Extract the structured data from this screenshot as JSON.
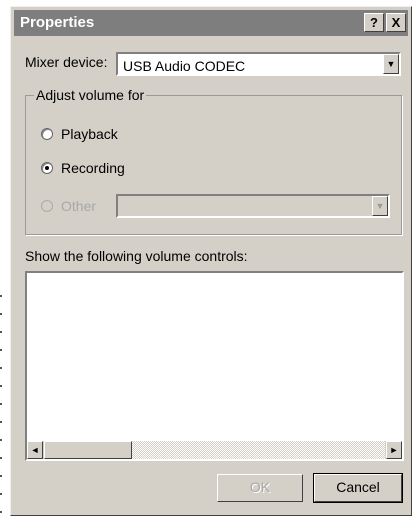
{
  "window": {
    "title": "Properties",
    "help_glyph": "?",
    "close_glyph": "X"
  },
  "mixer": {
    "label": "Mixer device:",
    "selected": "USB Audio CODEC",
    "arrow_glyph": "▼"
  },
  "adjust": {
    "legend": "Adjust volume for",
    "options": [
      {
        "label": "Playback",
        "checked": false,
        "enabled": true
      },
      {
        "label": "Recording",
        "checked": true,
        "enabled": true
      },
      {
        "label": "Other",
        "checked": false,
        "enabled": false
      }
    ],
    "other_selected": "",
    "arrow_glyph": "▼"
  },
  "controls": {
    "label": "Show the following volume controls:",
    "items": [],
    "scroll_left_glyph": "◄",
    "scroll_right_glyph": "►"
  },
  "buttons": {
    "ok": "OK",
    "ok_enabled": false,
    "cancel": "Cancel"
  },
  "colors": {
    "dialog_bg": "#d4d0c8",
    "titlebar_bg": "#7e7e7e"
  }
}
